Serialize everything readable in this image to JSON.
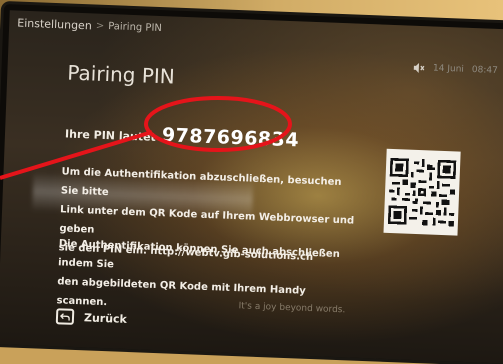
{
  "breadcrumb": {
    "root": "Einstellungen",
    "separator": ">",
    "current": "Pairing PIN"
  },
  "status": {
    "date": "14 Juni",
    "time": "08:47",
    "mute_icon": "mute-icon"
  },
  "page": {
    "title": "Pairing PIN"
  },
  "pin": {
    "label": "Ihre PIN lautet",
    "value": "9787696834"
  },
  "instructions": {
    "line1": "Um die Authentifikation abzuschließen, besuchen Sie bitte",
    "line2": "Link unter dem QR Kode auf Ihrem Webbrowser und geben",
    "line3": "sie den PIN ein. http://webtv.gib-solutions.ch",
    "line4": "Die Authentifikation können Sie auch abschließen indem Sie",
    "line5": "den abgebildeten QR Kode mit Ihrem Handy scannen."
  },
  "qr": {
    "icon": "qr-code"
  },
  "back": {
    "label": "Zurück",
    "icon": "back-icon"
  },
  "background": {
    "tagline": "It's a joy beyond words."
  },
  "colors": {
    "annotation": "#e5141a",
    "text": "#f3eee6"
  }
}
